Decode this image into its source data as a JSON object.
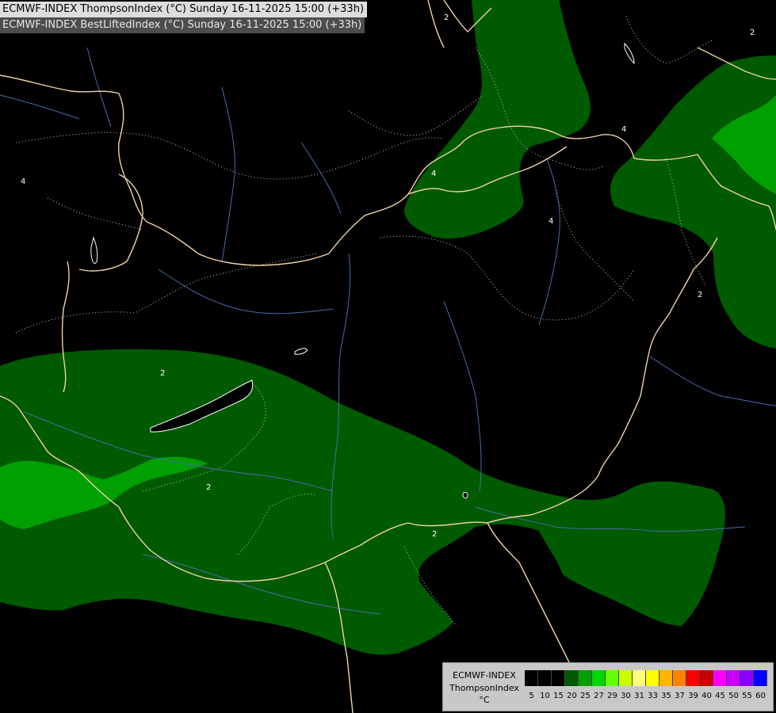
{
  "header": {
    "title_line1": "ECMWF-INDEX ThompsonIndex (°C) Sunday 16-11-2025 15:00 (+33h)",
    "title_line2": "ECMWF-INDEX BestLiftedIndex (°C) Sunday 16-11-2025 15:00 (+33h)"
  },
  "map": {
    "contour_labels": [
      "2",
      "4",
      "4",
      "2",
      "2",
      "4",
      "2",
      "4",
      "2",
      "2"
    ],
    "colors": {
      "background": "#000000",
      "band_20": "#005a00",
      "band_25": "#00a000",
      "contour": "#c8c8c8",
      "borders": "#f0d2a8",
      "rivers": "#4a6aa8",
      "lakes": "#ffffff"
    }
  },
  "legend": {
    "line1": "ECMWF-INDEX",
    "line2": "ThompsonIndex",
    "line3": "°C",
    "scale": [
      {
        "label": "5",
        "color": "#000000"
      },
      {
        "label": "10",
        "color": "#000000"
      },
      {
        "label": "15",
        "color": "#000000"
      },
      {
        "label": "20",
        "color": "#005a00"
      },
      {
        "label": "25",
        "color": "#00a000"
      },
      {
        "label": "27",
        "color": "#00d700"
      },
      {
        "label": "29",
        "color": "#64ff00"
      },
      {
        "label": "30",
        "color": "#c8ff00"
      },
      {
        "label": "31",
        "color": "#ffff80"
      },
      {
        "label": "33",
        "color": "#ffff00"
      },
      {
        "label": "35",
        "color": "#ffb400"
      },
      {
        "label": "37",
        "color": "#ff8200"
      },
      {
        "label": "39",
        "color": "#ff0000"
      },
      {
        "label": "40",
        "color": "#c80000"
      },
      {
        "label": "45",
        "color": "#ff00ff"
      },
      {
        "label": "50",
        "color": "#c800ff"
      },
      {
        "label": "55",
        "color": "#8c00ff"
      },
      {
        "label": "60",
        "color": "#0000ff"
      }
    ]
  }
}
